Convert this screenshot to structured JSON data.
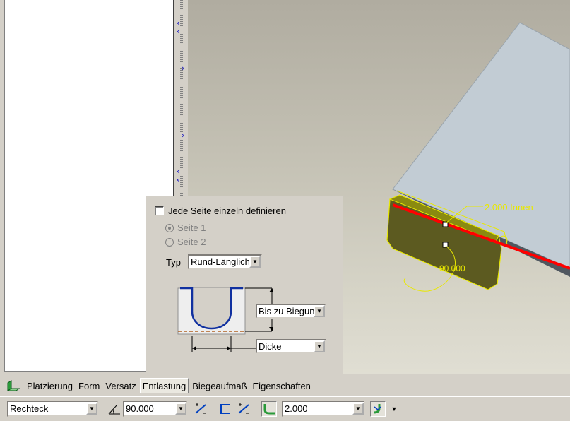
{
  "viewport": {
    "dimension_label": "2.000 Innen",
    "angle_label": "90.000"
  },
  "relief_panel": {
    "checkbox_label": "Jede Seite einzeln definieren",
    "checkbox_checked": false,
    "side1_label": "Seite 1",
    "side2_label": "Seite 2",
    "type_label": "Typ",
    "type_value": "Rund-Länglich",
    "depth_value": "Bis zu Biegung",
    "width_value": "Dicke"
  },
  "tabs": [
    {
      "label": "Platzierung"
    },
    {
      "label": "Form"
    },
    {
      "label": "Versatz"
    },
    {
      "label": "Entlastung"
    },
    {
      "label": "Biegeaufmaß"
    },
    {
      "label": "Eigenschaften"
    }
  ],
  "active_tab": "Entlastung",
  "toolbar": {
    "shape_value": "Rechteck",
    "angle_value": "90.000",
    "radius_value": "2.000"
  },
  "icons": {
    "tab_icon": "flange-wall-icon",
    "angle_icon": "angle-icon",
    "flip_icon": "flip-angle-icon",
    "profile_icon": "profile-icon",
    "radius_icon": "bend-radius-icon",
    "side_icon": "radius-side-icon"
  },
  "colors": {
    "highlight_yellow": "#e8e800",
    "edge_red": "#ff0000",
    "sheet_blue": "#c2ccd4",
    "profile_blue": "#1030a0",
    "dashed_orange": "#b06020"
  }
}
